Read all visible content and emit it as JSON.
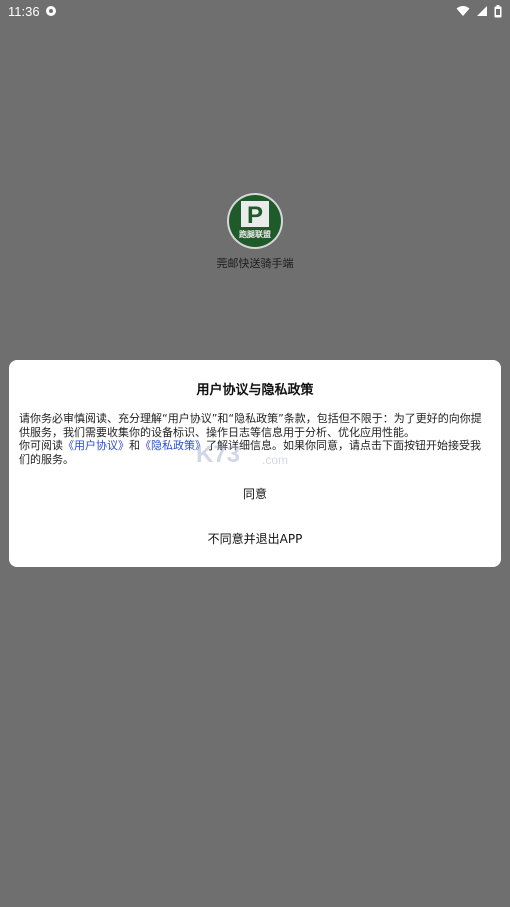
{
  "status_bar": {
    "time": "11:36",
    "icons": [
      "settings-icon",
      "wifi-icon",
      "signal-icon",
      "battery-icon"
    ]
  },
  "app": {
    "logo_letter": "P",
    "logo_text": "跑腿联盟",
    "name": "莞邮快送骑手端",
    "logo_color": "#1e5a2a"
  },
  "dialog": {
    "title": "用户协议与隐私政策",
    "paragraph1": "请你务必审慎阅读、充分理解“用户协议”和“隐私政策”条款，包括但不限于：为了更好的向你提供服务，我们需要收集你的设备标识、操作日志等信息用于分析、优化应用性能。",
    "p2_prefix": "你可阅读",
    "user_agreement_link": "《用户协议》",
    "p2_and": "和",
    "privacy_link": "《隐私政策》",
    "p2_suffix": "了解详细信息。如果你同意，请点击下面按钮开始接受我们的服务。",
    "agree_label": "同意",
    "exit_label": "不同意并退出APP",
    "link_color": "#2a4bd1"
  },
  "watermark": {
    "text": "K73",
    "sub": ".com"
  }
}
